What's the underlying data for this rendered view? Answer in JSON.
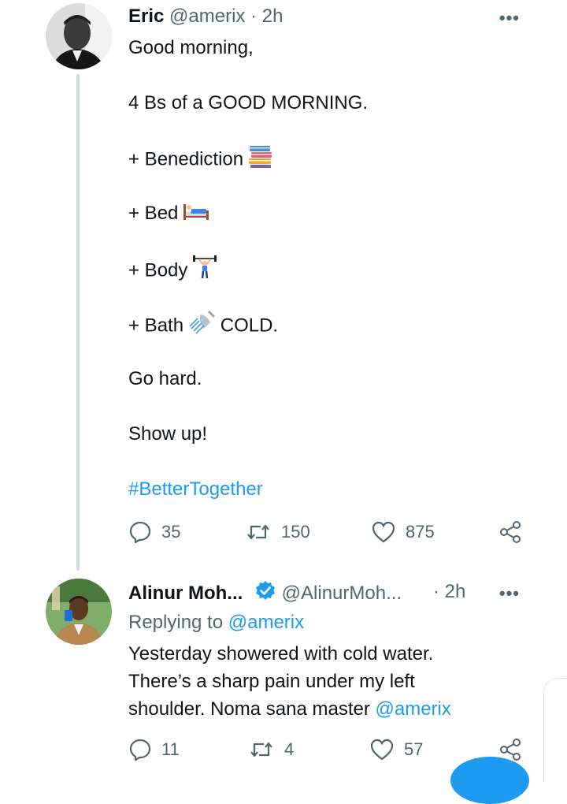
{
  "tweet1": {
    "name": "Eric",
    "handle": "@amerix",
    "sep": "·",
    "time": "2h",
    "more": "•••",
    "lines": [
      "Good morning,",
      "4 Bs of a GOOD MORNING.",
      "+ Benediction",
      "+ Bed",
      "+ Body",
      "+ Bath",
      "COLD.",
      "Go hard.",
      "Show up!"
    ],
    "hashtag": "#BetterTogether",
    "emoji_names": [
      "books-emoji",
      "bed-emoji",
      "weightlifter-emoji",
      "shower-emoji"
    ],
    "stats": {
      "replies": "35",
      "retweets": "150",
      "likes": "875"
    }
  },
  "tweet2": {
    "name": "Alinur Moh...",
    "handle": "@AlinurMoh...",
    "sep": "·",
    "time": "2h",
    "more": "•••",
    "replying_prefix": "Replying to",
    "replying_to": "@amerix",
    "text_lines": [
      "Yesterday showered with cold water.",
      "There’s a sharp pain under my left",
      "shoulder. Noma sana master"
    ],
    "mention": "@amerix",
    "stats": {
      "replies": "11",
      "retweets": "4",
      "likes": "57"
    }
  },
  "colors": {
    "link": "#1d9bf0",
    "muted": "#536471",
    "thread": "#cfd9de"
  }
}
